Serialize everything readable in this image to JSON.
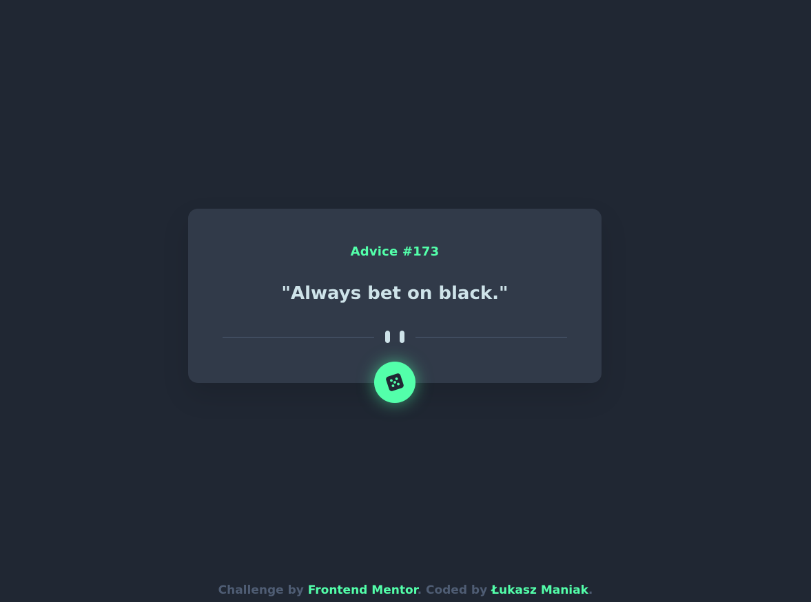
{
  "advice": {
    "id_label": "Advice #173",
    "text": "\"Always bet on black.\""
  },
  "footer": {
    "text_prefix": "Challenge by ",
    "mentor_link": "Frontend Mentor",
    "text_middle": ". Coded by ",
    "author_link": "Łukasz Maniak",
    "text_suffix": "."
  },
  "icons": {
    "divider": "pause-divider-icon",
    "button": "dice-icon"
  },
  "colors": {
    "background": "#202733",
    "card": "#313a49",
    "accent": "#53ffaa",
    "text": "#cee3e9",
    "muted": "#4f5d74"
  }
}
